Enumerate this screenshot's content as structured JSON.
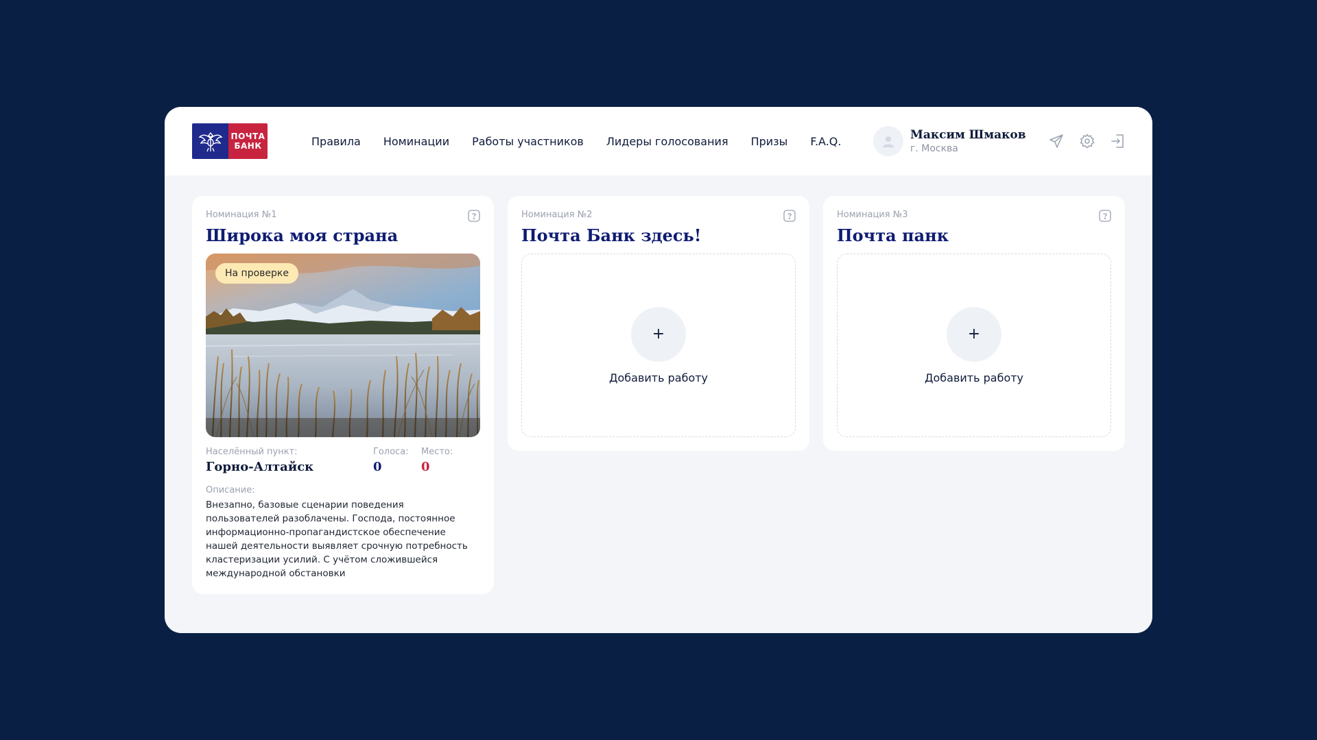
{
  "brand": {
    "name_line1": "ПОЧТА",
    "name_line2": "БАНК"
  },
  "nav": {
    "items": [
      "Правила",
      "Номинации",
      "Работы участников",
      "Лидеры голосования",
      "Призы",
      "F.A.Q."
    ]
  },
  "user": {
    "name": "Максим Шмаков",
    "city": "г. Москва"
  },
  "header_icons": [
    "send-icon",
    "settings-icon",
    "logout-icon"
  ],
  "nominations": [
    {
      "label": "Номинация №1",
      "title": "Широка моя страна",
      "status": "На проверке",
      "locality_label": "Населённый пункт:",
      "locality": "Горно-Алтайск",
      "votes_label": "Голоса:",
      "votes": "0",
      "place_label": "Место:",
      "place": "0",
      "description_label": "Описание:",
      "description": "Внезапно, базовые сценарии поведения пользователей разоблачены. Господа, постоянное информационно-пропагандистское обеспечение нашей деятельности выявляет срочную потребность кластеризации усилий. С учётом сложившейся международной обстановки"
    },
    {
      "label": "Номинация №2",
      "title": "Почта Банк здесь!",
      "add_label": "Добавить работу",
      "plus": "+"
    },
    {
      "label": "Номинация №3",
      "title": "Почта панк",
      "add_label": "Добавить работу",
      "plus": "+"
    }
  ],
  "colors": {
    "page_bg": "#0a1f44",
    "title_blue": "#0f1c72",
    "place_red": "#c8233f",
    "badge_bg": "#fde9b4"
  }
}
